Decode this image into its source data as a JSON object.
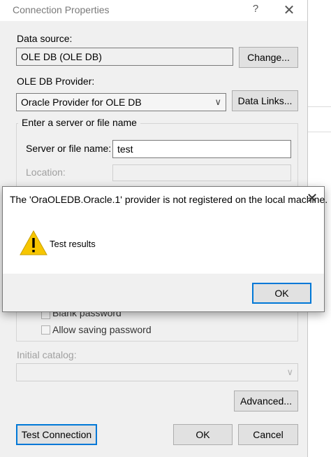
{
  "window": {
    "title": "Connection Properties",
    "help_glyph": "?",
    "close_glyph": "✕"
  },
  "data_source": {
    "label": "Data source:",
    "value": "OLE DB (OLE DB)",
    "change_button": "Change..."
  },
  "provider": {
    "label": "OLE DB Provider:",
    "selected": "Oracle Provider for OLE DB",
    "data_links_button": "Data Links..."
  },
  "server_group": {
    "legend": "Enter a server or file name",
    "server_label": "Server or file name:",
    "server_value": "test",
    "location_label": "Location:",
    "location_value": ""
  },
  "login": {
    "blank_password_label": "Blank password",
    "allow_saving_label": "Allow saving password"
  },
  "catalog": {
    "label": "Initial catalog:",
    "value": ""
  },
  "buttons": {
    "advanced": "Advanced...",
    "test_connection": "Test Connection",
    "ok": "OK",
    "cancel": "Cancel"
  },
  "modal": {
    "message": "The 'OraOLEDB.Oracle.1' provider is not registered on the local machine.",
    "result_text": "Test results",
    "ok_button": "OK",
    "close_glyph": "✕",
    "icon": "warning-icon",
    "icon_color": "#f7c600"
  }
}
